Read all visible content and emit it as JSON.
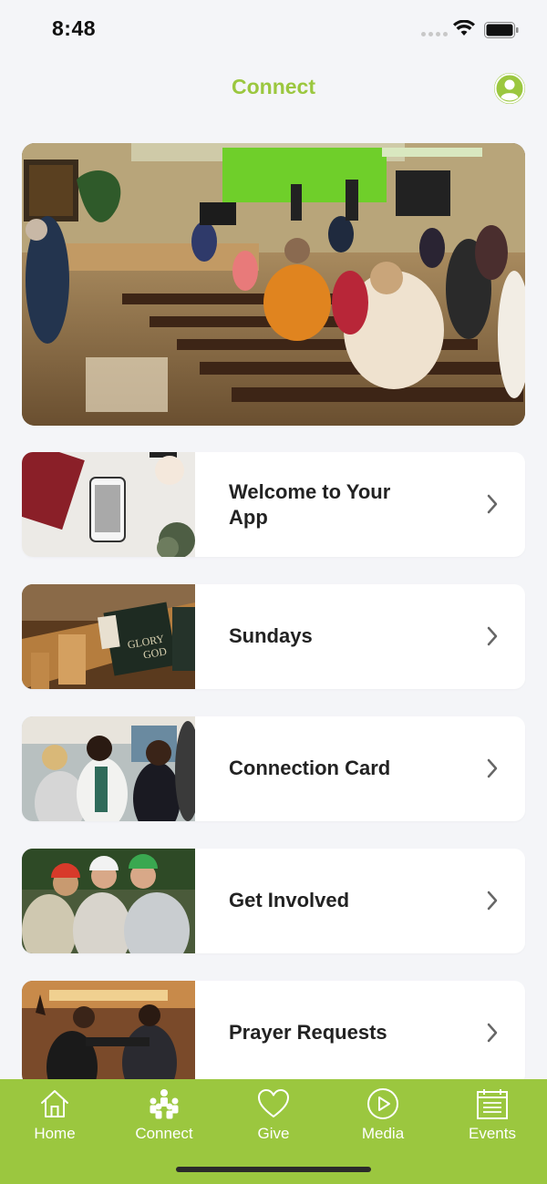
{
  "status_bar": {
    "time": "8:48"
  },
  "header": {
    "title": "Connect",
    "profile_icon": "person-circle-icon"
  },
  "hero": {
    "image": "church-worship-service-photo"
  },
  "cards": [
    {
      "label_line1": "Welcome to Your",
      "label_line2": "App",
      "image": "phone-on-desk-photo"
    },
    {
      "label": "Sundays",
      "image": "church-pew-hymnal-photo"
    },
    {
      "label": "Connection Card",
      "image": "people-chatting-photo"
    },
    {
      "label": "Get Involved",
      "image": "volunteers-hardhats-photo"
    },
    {
      "label": "Prayer Requests",
      "image": "people-praying-photo"
    }
  ],
  "tab_bar": {
    "tabs": [
      {
        "label": "Home",
        "icon": "home-icon"
      },
      {
        "label": "Connect",
        "icon": "people-icon"
      },
      {
        "label": "Give",
        "icon": "heart-icon"
      },
      {
        "label": "Media",
        "icon": "play-circle-icon"
      },
      {
        "label": "Events",
        "icon": "calendar-icon"
      }
    ]
  },
  "colors": {
    "accent": "#9bc73f",
    "background": "#f4f5f8",
    "card": "#ffffff",
    "text": "#222222"
  }
}
